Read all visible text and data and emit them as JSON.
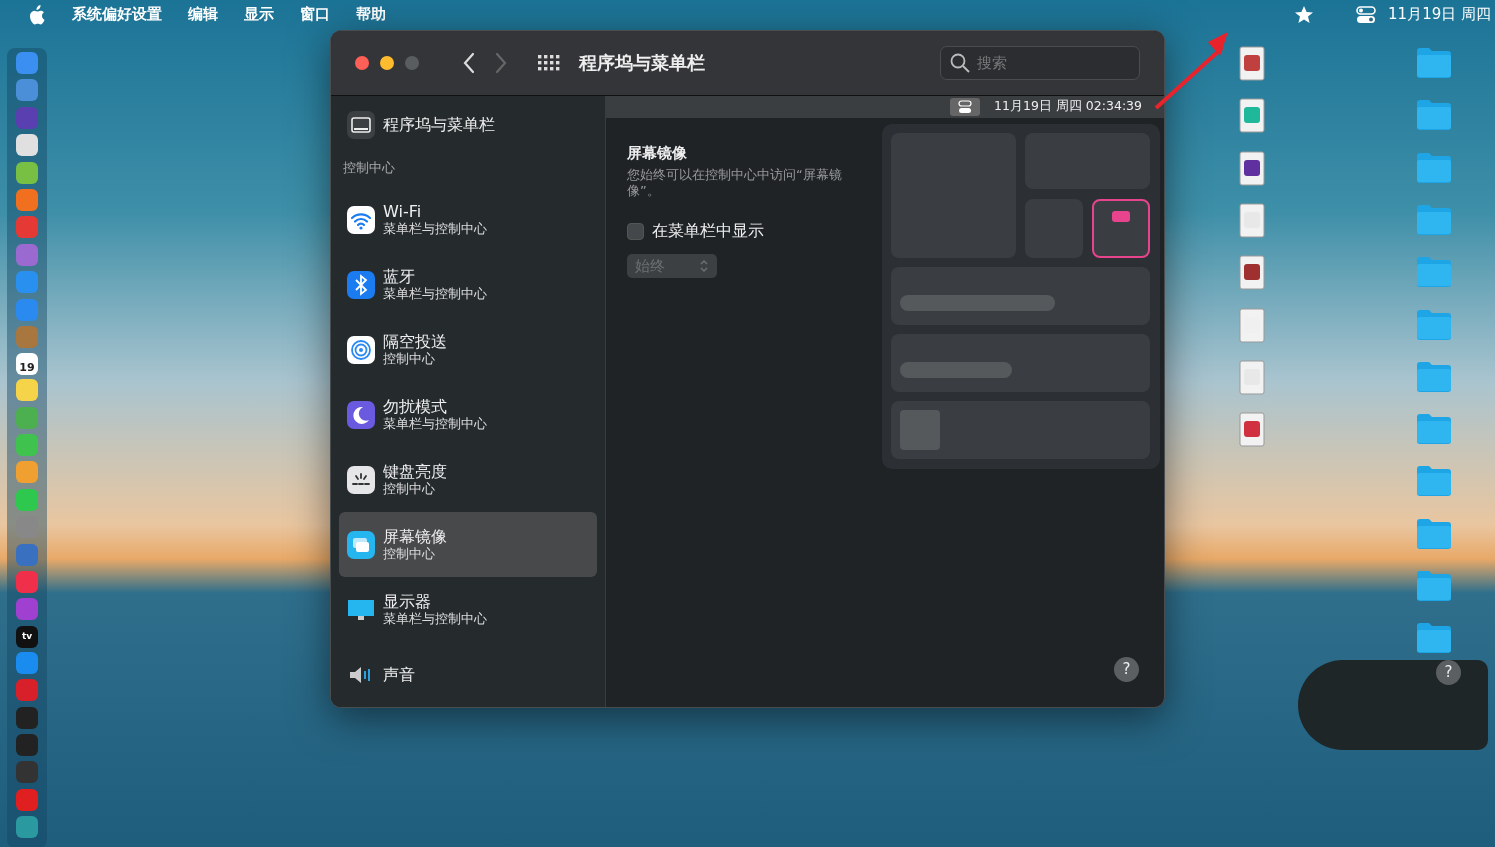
{
  "menubar": {
    "app_name": "系统偏好设置",
    "menus": [
      "编辑",
      "显示",
      "窗口",
      "帮助"
    ],
    "clock": "11月19日 周四"
  },
  "dock": {
    "calendar_day": "19",
    "tv_label": "tv"
  },
  "window": {
    "title": "程序坞与菜单栏",
    "back_enabled": true,
    "forward_enabled": false,
    "search": {
      "placeholder": "搜索"
    }
  },
  "sidebar": {
    "top_item": {
      "label": "程序坞与菜单栏",
      "selected": false
    },
    "section": "控制中心",
    "items": [
      {
        "kind": "wifi",
        "title": "Wi-Fi",
        "subtitle": "菜单栏与控制中心",
        "selected": false
      },
      {
        "kind": "bluetooth",
        "title": "蓝牙",
        "subtitle": "菜单栏与控制中心",
        "selected": false
      },
      {
        "kind": "airdrop",
        "title": "隔空投送",
        "subtitle": "控制中心",
        "selected": false
      },
      {
        "kind": "focus",
        "title": "勿扰模式",
        "subtitle": "菜单栏与控制中心",
        "selected": false
      },
      {
        "kind": "keyboard",
        "title": "键盘亮度",
        "subtitle": "控制中心",
        "selected": false
      },
      {
        "kind": "mirroring",
        "title": "屏幕镜像",
        "subtitle": "控制中心",
        "selected": true
      },
      {
        "kind": "display",
        "title": "显示器",
        "subtitle": "菜单栏与控制中心",
        "selected": false
      },
      {
        "kind": "sound",
        "title": "声音",
        "selected": false
      }
    ]
  },
  "preview_menubar": {
    "clock": "11月19日 周四 02:34:39"
  },
  "detail": {
    "heading": "屏幕镜像",
    "description": "您始终可以在控制中心中访问“屏幕镜像”。",
    "show_in_menubar": {
      "label": "在菜单栏中显示",
      "checked": false
    },
    "popup": {
      "value": "始终",
      "disabled": true
    }
  },
  "help": "?",
  "desktop_help": "?"
}
